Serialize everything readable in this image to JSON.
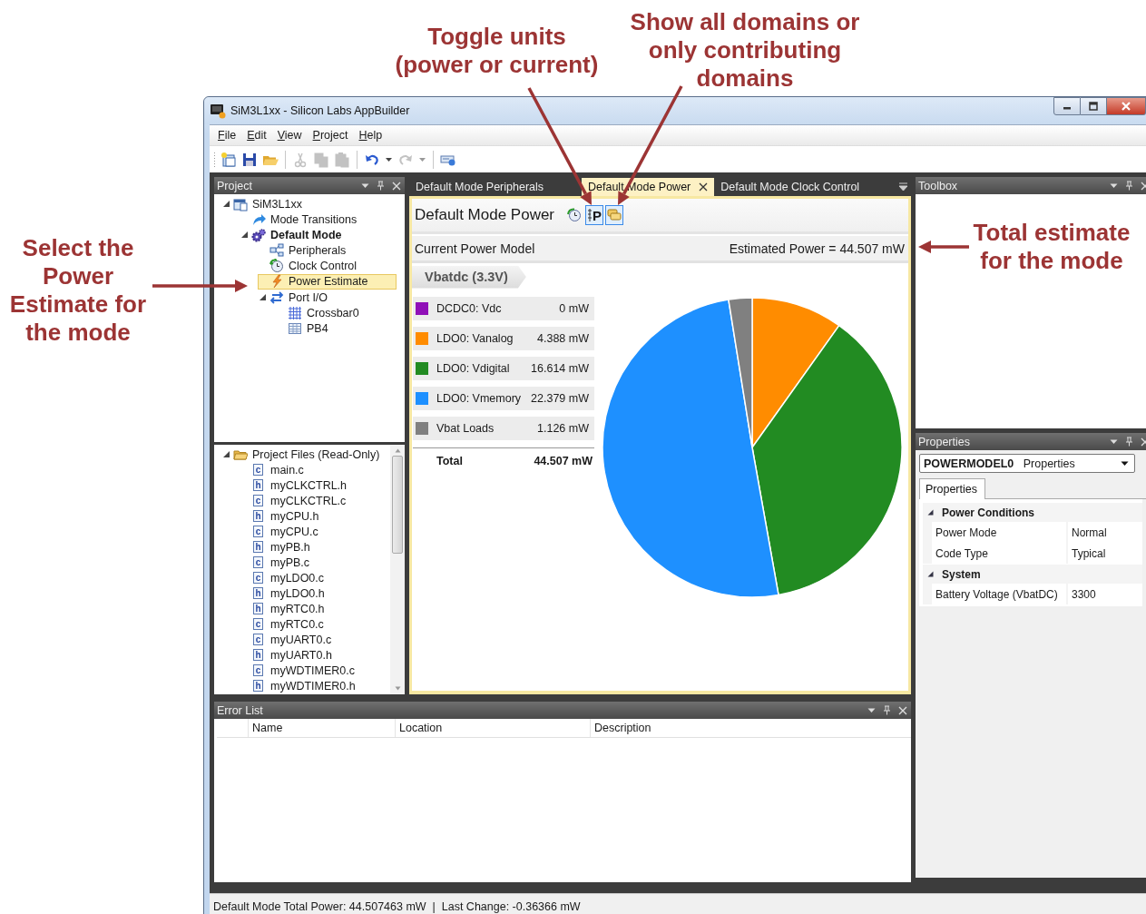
{
  "annotations": [
    {
      "text": "Toggle units\n(power or current)"
    },
    {
      "text": "Show all domains or\nonly contributing\ndomains"
    },
    {
      "text": "Select the\nPower\nEstimate for\nthe mode"
    },
    {
      "text": "Total estimate\nfor the mode"
    }
  ],
  "window": {
    "title": "SiM3L1xx - Silicon Labs AppBuilder"
  },
  "menu": [
    "File",
    "Edit",
    "View",
    "Project",
    "Help"
  ],
  "toolbar": [
    {
      "kind": "new",
      "disabled": false
    },
    {
      "kind": "save",
      "disabled": false
    },
    {
      "kind": "open",
      "disabled": false
    },
    {
      "kind": "separator"
    },
    {
      "kind": "cut",
      "disabled": true
    },
    {
      "kind": "copy",
      "disabled": true
    },
    {
      "kind": "paste",
      "disabled": true
    },
    {
      "kind": "separator"
    },
    {
      "kind": "undo",
      "disabled": false
    },
    {
      "kind": "dropdown",
      "disabled": false
    },
    {
      "kind": "redo",
      "disabled": true
    },
    {
      "kind": "dropdown",
      "disabled": true
    },
    {
      "kind": "separator"
    },
    {
      "kind": "device",
      "disabled": false
    }
  ],
  "project_panel": {
    "title": "Project",
    "tree": [
      {
        "label": "SiM3L1xx",
        "kind": "project",
        "active": false,
        "selected": false,
        "expanded": true,
        "children": [
          {
            "label": "Mode Transitions",
            "kind": "transitions",
            "active": false,
            "selected": false
          },
          {
            "label": "Default Mode",
            "kind": "mode",
            "active": true,
            "selected": false,
            "expanded": true,
            "children": [
              {
                "label": "Peripherals",
                "kind": "peripherals",
                "active": false,
                "selected": false
              },
              {
                "label": "Clock Control",
                "kind": "clock",
                "active": false,
                "selected": false
              },
              {
                "label": "Power Estimate",
                "kind": "power",
                "active": false,
                "selected": true
              },
              {
                "label": "Port I/O",
                "kind": "port",
                "active": false,
                "selected": false,
                "expanded": true,
                "children": [
                  {
                    "label": "Crossbar0",
                    "kind": "crossbar",
                    "active": false,
                    "selected": false
                  },
                  {
                    "label": "PB4",
                    "kind": "pin",
                    "active": false,
                    "selected": false
                  }
                ]
              }
            ]
          }
        ]
      }
    ]
  },
  "files_panel": {
    "tree": [
      {
        "label": "Project Files (Read-Only)",
        "kind": "folder",
        "selected": false,
        "expanded": true,
        "children": [
          {
            "label": "main.c",
            "kind": "file",
            "file_type": "c",
            "selected": false
          },
          {
            "label": "myCLKCTRL.h",
            "kind": "file",
            "file_type": "h",
            "selected": false
          },
          {
            "label": "myCLKCTRL.c",
            "kind": "file",
            "file_type": "c",
            "selected": false
          },
          {
            "label": "myCPU.h",
            "kind": "file",
            "file_type": "h",
            "selected": false
          },
          {
            "label": "myCPU.c",
            "kind": "file",
            "file_type": "c",
            "selected": false
          },
          {
            "label": "myPB.h",
            "kind": "file",
            "file_type": "h",
            "selected": false
          },
          {
            "label": "myPB.c",
            "kind": "file",
            "file_type": "c",
            "selected": false
          },
          {
            "label": "myLDO0.c",
            "kind": "file",
            "file_type": "c",
            "selected": false
          },
          {
            "label": "myLDO0.h",
            "kind": "file",
            "file_type": "h",
            "selected": false
          },
          {
            "label": "myRTC0.h",
            "kind": "file",
            "file_type": "h",
            "selected": false
          },
          {
            "label": "myRTC0.c",
            "kind": "file",
            "file_type": "c",
            "selected": false
          },
          {
            "label": "myUART0.c",
            "kind": "file",
            "file_type": "c",
            "selected": false
          },
          {
            "label": "myUART0.h",
            "kind": "file",
            "file_type": "h",
            "selected": false
          },
          {
            "label": "myWDTIMER0.c",
            "kind": "file",
            "file_type": "c",
            "selected": false
          },
          {
            "label": "myWDTIMER0.h",
            "kind": "file",
            "file_type": "h",
            "selected": false
          }
        ]
      }
    ]
  },
  "document": {
    "tabs": [
      {
        "label": "Default Mode Peripherals",
        "selected": false
      },
      {
        "label": "Default Mode Power",
        "selected": true
      },
      {
        "label": "Default Mode Clock Control",
        "selected": false
      }
    ],
    "heading": "Default Mode Power",
    "tools": [
      {
        "kind": "refresh",
        "on": false
      },
      {
        "kind": "units",
        "glyph": "P",
        "on": true
      },
      {
        "kind": "domains",
        "on": true
      }
    ],
    "model_label": "Current Power Model",
    "estimate": "Estimated Power = 44.507 mW",
    "supply": "Vbatdc (3.3V)",
    "rails": [
      {
        "name": "DCDC0: Vdc",
        "value": "0 mW",
        "color": "#9010b8"
      },
      {
        "name": "LDO0: Vanalog",
        "value": "4.388 mW",
        "color": "#ff8c00"
      },
      {
        "name": "LDO0: Vdigital",
        "value": "16.614 mW",
        "color": "#228b22"
      },
      {
        "name": "LDO0: Vmemory",
        "value": "22.379 mW",
        "color": "#1e90ff"
      },
      {
        "name": "Vbat Loads",
        "value": "1.126 mW",
        "color": "#808080"
      }
    ],
    "total": {
      "label": "Total",
      "value": "44.507 mW"
    },
    "chart_data": {
      "type": "pie",
      "values": [
        0,
        9.859,
        37.329,
        50.282,
        2.53
      ]
    }
  },
  "toolbox": {
    "title": "Toolbox"
  },
  "properties": {
    "title": "Properties",
    "selector": "**POWERMODEL0**   Properties",
    "tabs": [
      {
        "label": "Properties",
        "selected": true
      }
    ],
    "categories": [
      {
        "label": "Power Conditions",
        "expanded": true,
        "rows": [
          {
            "name": "Power Mode",
            "value": "Normal"
          },
          {
            "name": "Code Type",
            "value": "Typical"
          }
        ]
      },
      {
        "label": "System",
        "expanded": true,
        "rows": [
          {
            "name": "Battery Voltage (VbatDC)",
            "value": "3300"
          }
        ]
      }
    ]
  },
  "error_list": {
    "title": "Error List",
    "columns": [
      "Name",
      "Location",
      "Description"
    ]
  },
  "status_bar": "Default Mode Total Power: 44.507463 mW  |  Last Change: -0.36366 mW"
}
